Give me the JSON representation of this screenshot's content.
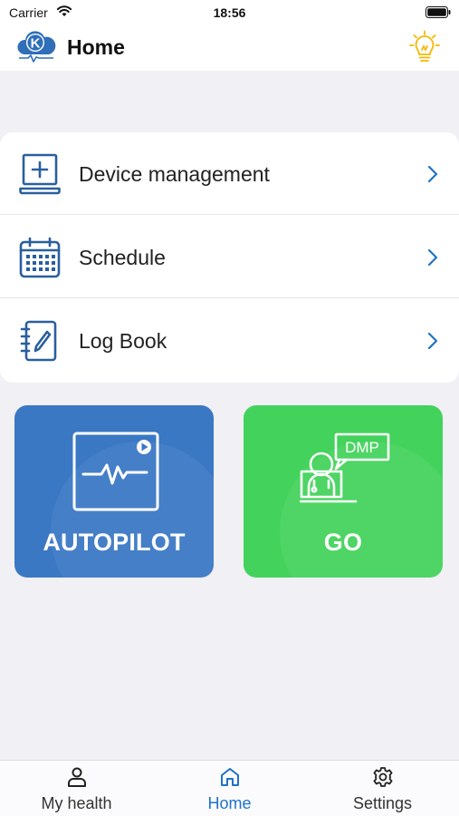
{
  "status_bar": {
    "carrier": "Carrier",
    "time": "18:56"
  },
  "header": {
    "title": "Home",
    "logo_letter": "K",
    "logo_icon": "k-cloud-logo",
    "action_icon": "lightbulb-icon"
  },
  "menu": {
    "items": [
      {
        "label": "Device management",
        "icon": "laptop-plus-icon"
      },
      {
        "label": "Schedule",
        "icon": "calendar-icon"
      },
      {
        "label": "Log Book",
        "icon": "notebook-pen-icon"
      }
    ]
  },
  "tiles": {
    "autopilot": {
      "label": "AUTOPILOT",
      "icon": "monitor-heartbeat-icon"
    },
    "go": {
      "label": "GO",
      "icon": "doctor-dmp-icon",
      "badge_text": "DMP"
    }
  },
  "tab_bar": {
    "tabs": [
      {
        "label": "My health",
        "icon": "person-icon",
        "active": false
      },
      {
        "label": "Home",
        "icon": "home-icon",
        "active": true
      },
      {
        "label": "Settings",
        "icon": "gear-icon",
        "active": false
      }
    ]
  },
  "colors": {
    "accent": "#1f72c7",
    "autopilot_tile": "#3a78c4",
    "go_tile": "#43d35c",
    "bulb": "#f5b800",
    "background": "#f0f0f5"
  }
}
